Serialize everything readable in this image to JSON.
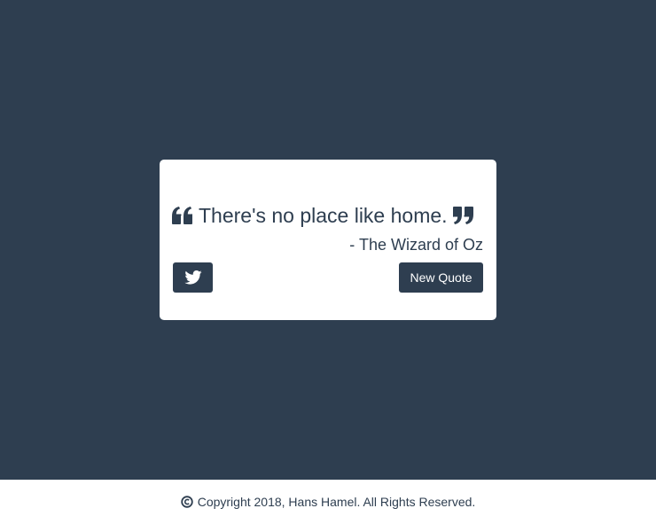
{
  "colors": {
    "background": "#2e3e50",
    "card": "#ffffff",
    "text": "#2e3e50",
    "button": "#2e3e50",
    "button_text": "#ffffff"
  },
  "quote": {
    "open_mark_icon": "quote-left-icon",
    "text": "There's no place like home.",
    "close_mark_icon": "quote-right-icon",
    "author": "- The Wizard of Oz"
  },
  "buttons": {
    "tweet_icon": "twitter-icon",
    "new_quote_label": "New Quote"
  },
  "footer": {
    "icon": "copyright-icon",
    "text": "Copyright 2018, Hans Hamel. All Rights Reserved."
  }
}
